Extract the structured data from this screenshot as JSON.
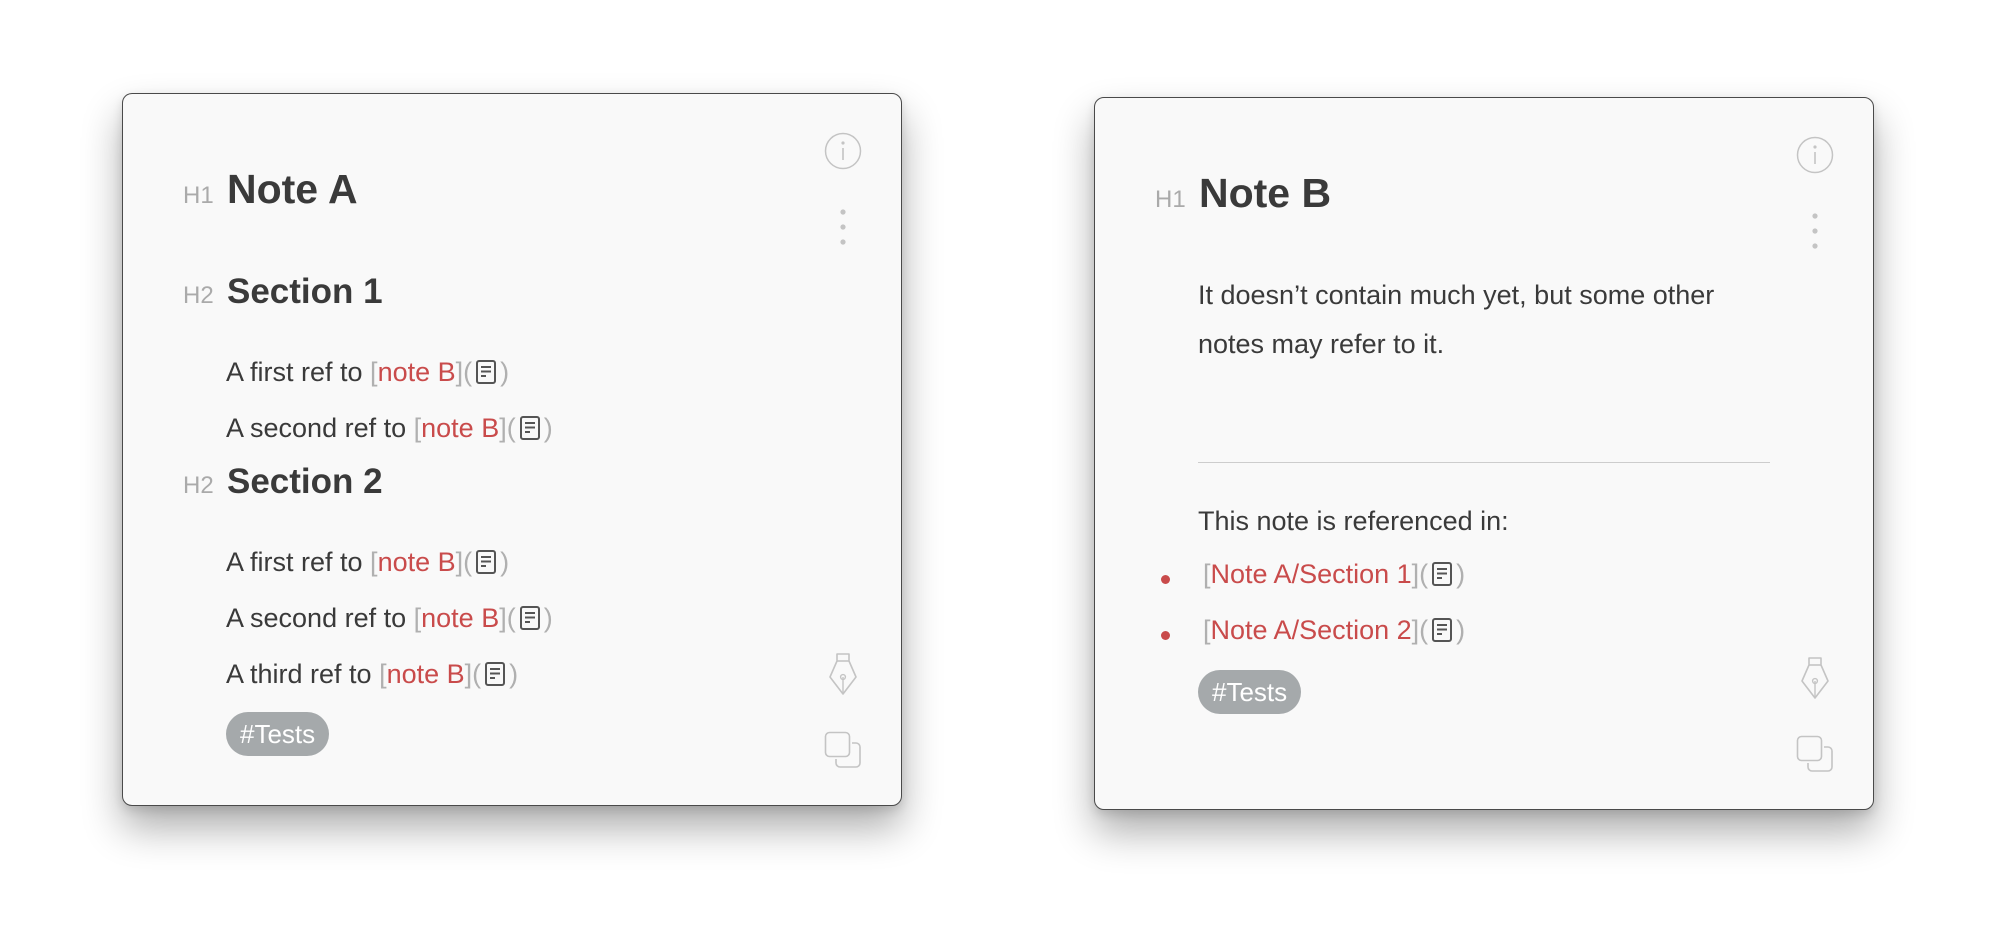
{
  "note_a": {
    "title": "Note A",
    "h1_marker": "H1",
    "h2_marker": "H2",
    "sections": [
      {
        "title": "Section 1",
        "refs": [
          {
            "prefix": "A first ref to ",
            "link": "note B"
          },
          {
            "prefix": "A second ref to ",
            "link": "note B"
          }
        ]
      },
      {
        "title": "Section 2",
        "refs": [
          {
            "prefix": "A first ref to ",
            "link": "note B"
          },
          {
            "prefix": "A second ref to ",
            "link": "note B"
          },
          {
            "prefix": "A third ref to ",
            "link": "note B"
          }
        ]
      }
    ],
    "tag": "#Tests"
  },
  "note_b": {
    "title": "Note B",
    "h1_marker": "H1",
    "body": "It doesn’t contain much yet, but some other notes may refer to it.",
    "referenced_label": "This note is referenced in:",
    "backlinks": [
      "Note A/Section 1",
      "Note A/Section 2"
    ],
    "tag": "#Tests"
  },
  "icons": [
    "info-icon",
    "more-icon",
    "pen-icon",
    "copy-icon",
    "document-icon"
  ],
  "colors": {
    "link": "#c94b4b",
    "bracket": "#b0b0b0",
    "tag_bg": "#a5a9ab",
    "text": "#3a3a3a"
  }
}
